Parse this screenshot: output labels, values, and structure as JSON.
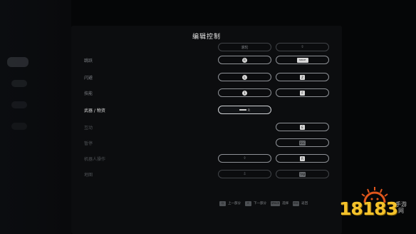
{
  "panel": {
    "title": "编辑控制"
  },
  "rows": [
    {
      "label": "",
      "primary": {
        "type": "text",
        "value": "滚轮"
      },
      "secondary": {
        "type": "text",
        "value": "⇧"
      },
      "state": "dim"
    },
    {
      "label": "跳跃",
      "primary": {
        "type": "round",
        "value": "R"
      },
      "secondary": {
        "type": "wide",
        "value": "SPACE"
      },
      "state": "normal"
    },
    {
      "label": "闪避",
      "primary": {
        "type": "round",
        "value": "L"
      },
      "secondary": {
        "type": "key",
        "value": "Z"
      },
      "state": "normal"
    },
    {
      "label": "技能",
      "primary": {
        "type": "round",
        "value": "1"
      },
      "secondary": {
        "type": "key",
        "value": "F"
      },
      "state": "normal"
    },
    {
      "label": "武器 / 物资",
      "primary": {
        "type": "mouse",
        "value": "R"
      },
      "secondary": {
        "type": "none",
        "value": ""
      },
      "state": "active"
    },
    {
      "label": "互动",
      "primary": {
        "type": "none",
        "value": ""
      },
      "secondary": {
        "type": "key",
        "value": "E"
      },
      "state": "dim"
    },
    {
      "label": "暂停",
      "primary": {
        "type": "none",
        "value": ""
      },
      "secondary": {
        "type": "key",
        "value": "ESC"
      },
      "state": "dim"
    },
    {
      "label": "机器人操作",
      "primary": {
        "type": "text",
        "value": "⇧"
      },
      "secondary": {
        "type": "key",
        "value": "R"
      },
      "state": "dim"
    },
    {
      "label": "地图",
      "primary": {
        "type": "text",
        "value": "⇩"
      },
      "secondary": {
        "type": "key",
        "value": "TAB"
      },
      "state": "dim"
    }
  ],
  "footer": {
    "items": [
      {
        "key": "Q",
        "label": "上一部分"
      },
      {
        "key": "E",
        "label": "下一部分"
      },
      {
        "key": "SPACE",
        "label": "选择"
      },
      {
        "key": "ESC",
        "label": "返回"
      }
    ]
  },
  "watermark": {
    "number": "18183",
    "text": "手游网"
  },
  "colors": {
    "background": "#050607",
    "panel": "#0c0d0f",
    "accent": "#f4c22b"
  }
}
